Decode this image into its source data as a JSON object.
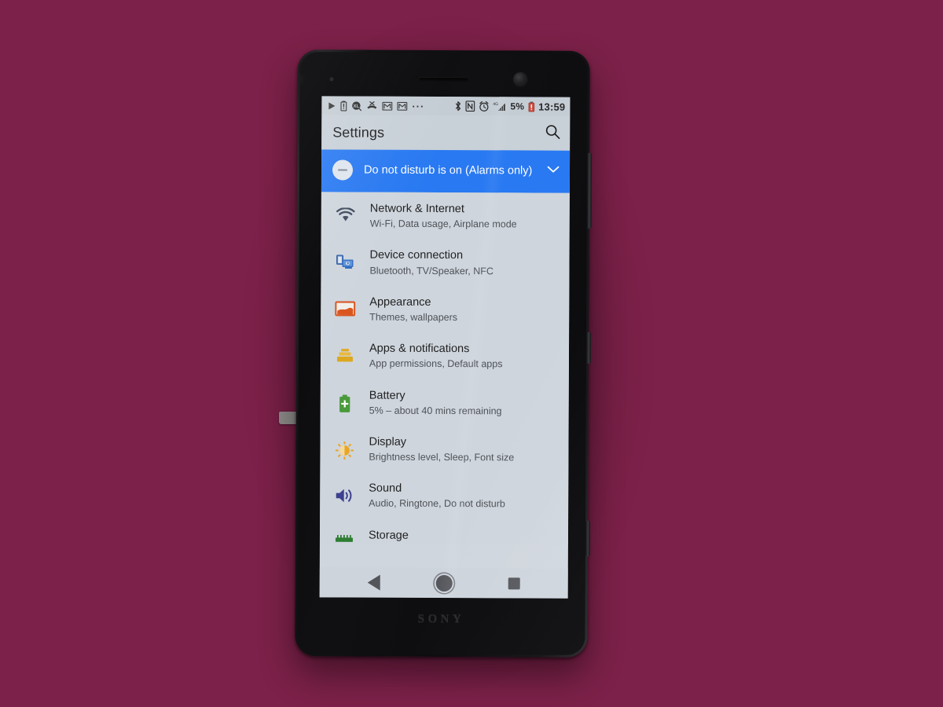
{
  "device": {
    "brand": "SONY",
    "side_buttons": [
      "volume-rocker",
      "power-button",
      "camera-shutter"
    ]
  },
  "colors": {
    "backdrop": "#7c2149",
    "screen_bg": "#ced5dd",
    "statusbar_bg": "#c4ccd4",
    "appbar_bg": "#c8d0d8",
    "dnd_banner": "#2979f2",
    "title_text": "#1f1f1f",
    "subtitle_text": "#4f5257",
    "icon_wifi": "#3f4b5c",
    "icon_device": "#2f6bbf",
    "icon_appearance": "#d9541e",
    "icon_apps": "#e0ac2b",
    "icon_battery": "#4a9a3c",
    "icon_display": "#e8a623",
    "icon_sound": "#3d3f8f",
    "icon_storage": "#2e7d32"
  },
  "statusbar": {
    "left_icons": [
      {
        "name": "play-icon",
        "glyph": "▶"
      },
      {
        "name": "battery-alert-icon",
        "glyph": "🖴"
      },
      {
        "name": "xl-badge-icon",
        "glyph": "XL"
      },
      {
        "name": "missed-call-icon",
        "glyph": "✕"
      },
      {
        "name": "gmail-icon-1",
        "glyph": "M"
      },
      {
        "name": "gmail-icon-2",
        "glyph": "M"
      },
      {
        "name": "more-notifications-icon",
        "glyph": "···"
      }
    ],
    "right_icons": [
      {
        "name": "bluetooth-icon",
        "glyph": "✱"
      },
      {
        "name": "nfc-icon",
        "glyph": "N"
      },
      {
        "name": "alarm-icon",
        "glyph": "⏰"
      }
    ],
    "network_label": "4G",
    "battery_percent": "5%",
    "clock": "13:59"
  },
  "appbar": {
    "title": "Settings",
    "search_icon": "search-icon"
  },
  "dnd_banner": {
    "text": "Do not disturb is on (Alarms only)",
    "badge_icon": "do-not-disturb-icon",
    "expand_icon": "chevron-down-icon"
  },
  "settings_list": [
    {
      "id": "network-internet",
      "icon": "wifi-icon",
      "title": "Network & Internet",
      "subtitle": "Wi-Fi, Data usage, Airplane mode"
    },
    {
      "id": "device-connection",
      "icon": "device-connection-icon",
      "title": "Device connection",
      "subtitle": "Bluetooth, TV/Speaker, NFC"
    },
    {
      "id": "appearance",
      "icon": "appearance-image-icon",
      "title": "Appearance",
      "subtitle": "Themes, wallpapers"
    },
    {
      "id": "apps-notifications",
      "icon": "apps-stack-icon",
      "title": "Apps & notifications",
      "subtitle": "App permissions, Default apps"
    },
    {
      "id": "battery",
      "icon": "battery-icon",
      "title": "Battery",
      "subtitle": "5% – about 40 mins remaining"
    },
    {
      "id": "display",
      "icon": "brightness-icon",
      "title": "Display",
      "subtitle": "Brightness level, Sleep, Font size"
    },
    {
      "id": "sound",
      "icon": "volume-icon",
      "title": "Sound",
      "subtitle": "Audio, Ringtone, Do not disturb"
    },
    {
      "id": "storage",
      "icon": "storage-icon",
      "title": "Storage",
      "subtitle": ""
    }
  ],
  "navbar": {
    "back": "back-button",
    "home": "home-button",
    "recents": "recents-button"
  }
}
